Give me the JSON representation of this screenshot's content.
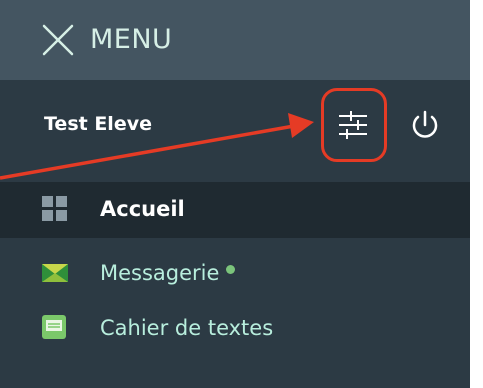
{
  "header": {
    "close_icon": "close-icon",
    "menu_label": "MENU"
  },
  "user": {
    "name": "Test Eleve",
    "settings_icon": "sliders-icon",
    "power_icon": "power-icon"
  },
  "nav": {
    "items": [
      {
        "label": "Accueil",
        "icon": "grid-icon",
        "active": true
      },
      {
        "label": "Messagerie",
        "icon": "envelope-icon",
        "active": false,
        "status_dot": true
      },
      {
        "label": "Cahier de textes",
        "icon": "notebook-icon",
        "active": false
      }
    ]
  },
  "colors": {
    "panel_bg": "#2c3a44",
    "header_bg": "#445561",
    "active_bg": "#1f2a31",
    "nav_text": "#b8eedd",
    "annotation_red": "#e53b25",
    "status_green": "#7bc47b"
  }
}
